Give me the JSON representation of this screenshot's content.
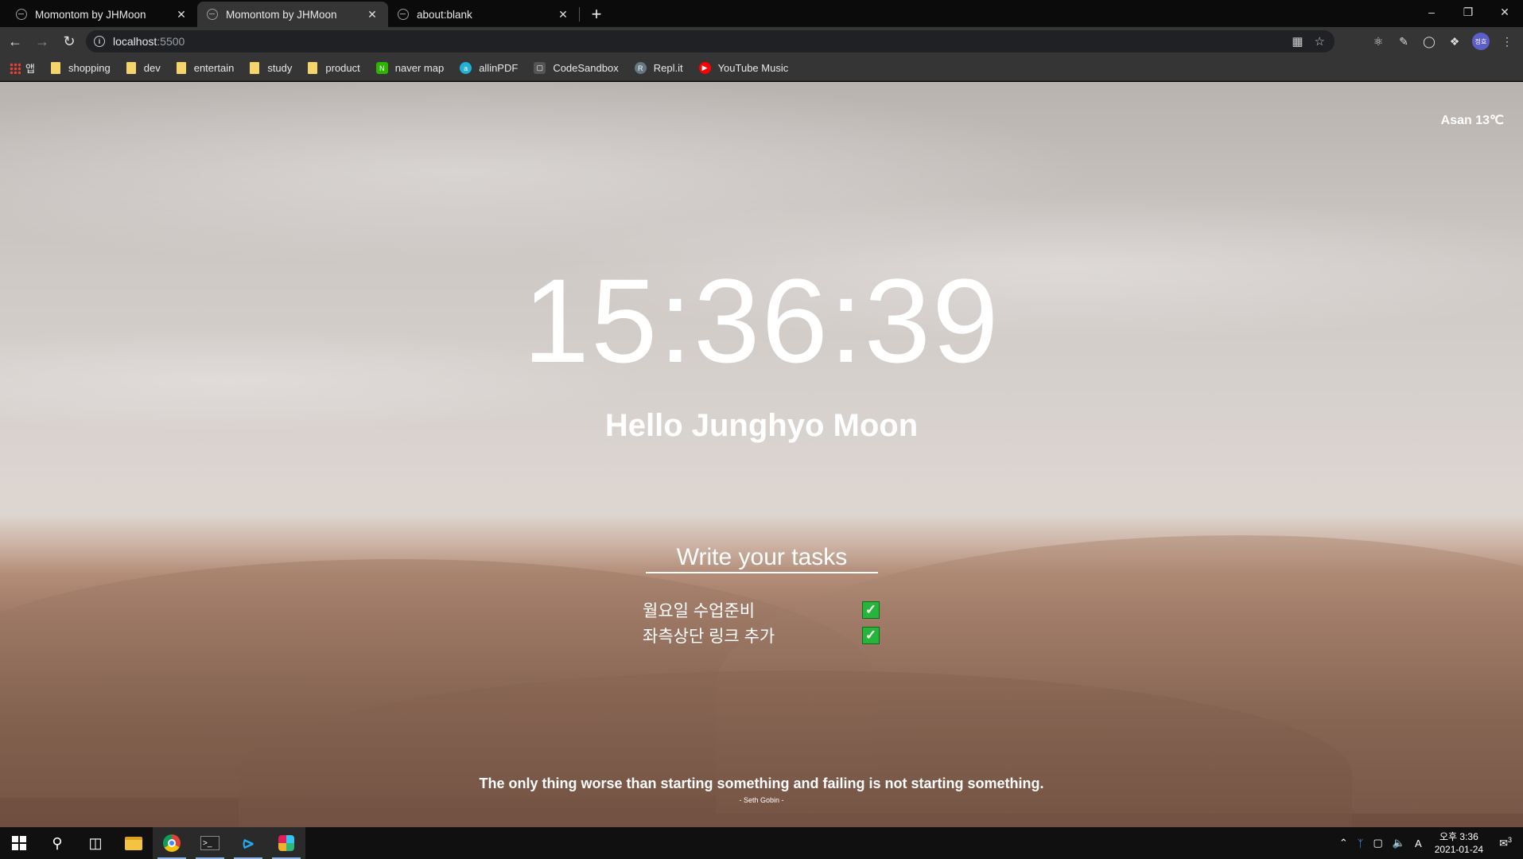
{
  "browser": {
    "tabs": [
      {
        "title": "Momontom by JHMoon",
        "close": "✕"
      },
      {
        "title": "Momontom by JHMoon",
        "close": "✕"
      },
      {
        "title": "about:blank",
        "close": "✕"
      }
    ],
    "new_tab": "+",
    "address": {
      "host": "localhost",
      "port": ":5500"
    },
    "bookmarks": [
      {
        "label": "앱",
        "type": "apps"
      },
      {
        "label": "shopping",
        "type": "folder"
      },
      {
        "label": "dev",
        "type": "folder"
      },
      {
        "label": "entertain",
        "type": "folder"
      },
      {
        "label": "study",
        "type": "folder"
      },
      {
        "label": "product",
        "type": "folder"
      },
      {
        "label": "naver map",
        "type": "site",
        "color": "#2db400"
      },
      {
        "label": "allinPDF",
        "type": "site",
        "color": "#21b0d6"
      },
      {
        "label": "CodeSandbox",
        "type": "site",
        "color": "#555555"
      },
      {
        "label": "Repl.it",
        "type": "site",
        "color": "#667881"
      },
      {
        "label": "YouTube Music",
        "type": "site",
        "color": "#ff0000"
      }
    ],
    "profile_initials": "정효"
  },
  "app": {
    "weather": "Asan 13℃",
    "clock": "15:36:39",
    "greeting": "Hello Junghyo Moon",
    "task_placeholder": "Write your tasks",
    "tasks": [
      {
        "text": "월요일 수업준비",
        "checked": true
      },
      {
        "text": "좌측상단 링크 추가",
        "checked": true
      }
    ],
    "quote": "The only thing worse than starting something and failing is not starting something.",
    "author": "- Seth Gobin -"
  },
  "taskbar": {
    "time": "오후 3:36",
    "date": "2021-01-24",
    "ime": "A",
    "notification_count": "3"
  }
}
